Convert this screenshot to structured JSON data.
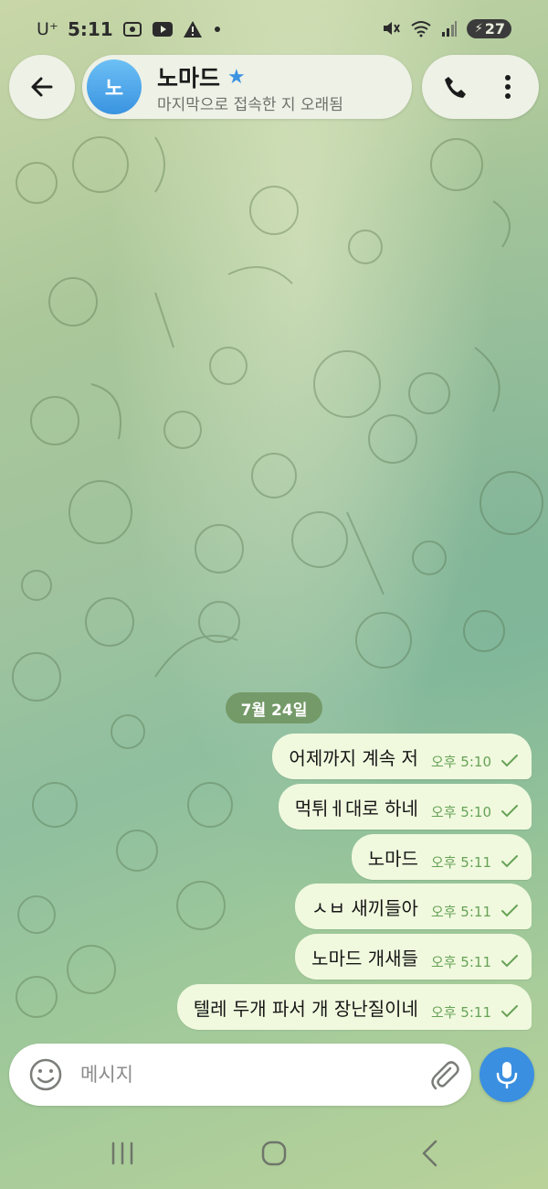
{
  "status_bar": {
    "carrier": "U⁺",
    "time": "5:11",
    "battery": "27",
    "icons": [
      "screenshot-icon",
      "youtube-icon",
      "warning-icon",
      "dot-icon",
      "mute-icon",
      "wifi-icon",
      "signal-icon",
      "battery-icon"
    ]
  },
  "header": {
    "avatar_initial": "노",
    "contact_name": "노마드",
    "contact_status": "마지막으로 접속한 지 오래됨",
    "icons": [
      "back-arrow-icon",
      "star-icon",
      "phone-icon",
      "more-vertical-icon"
    ]
  },
  "chat": {
    "date_label": "7월 24일",
    "messages": [
      {
        "text": "어제까지 계속 저",
        "time": "오후 5:10"
      },
      {
        "text": "먹튀ㅔ대로 하네",
        "time": "오후 5:10"
      },
      {
        "text": "노마드",
        "time": "오후 5:11"
      },
      {
        "text": "ㅅㅂ 새끼들아",
        "time": "오후 5:11"
      },
      {
        "text": "노마드 개새들",
        "time": "오후 5:11"
      },
      {
        "text": "텔레 두개 파서 개 장난질이네",
        "time": "오후 5:11"
      }
    ]
  },
  "composer": {
    "placeholder": "메시지",
    "value": "",
    "icons": [
      "emoji-icon",
      "paperclip-icon",
      "microphone-icon"
    ]
  },
  "nav": {
    "icons": [
      "recents-icon",
      "home-icon",
      "nav-back-icon"
    ]
  },
  "colors": {
    "bubble": "#f0f9de",
    "time_text": "#67a257",
    "accent": "#3a8fe0",
    "date_chip": "#698c55"
  }
}
